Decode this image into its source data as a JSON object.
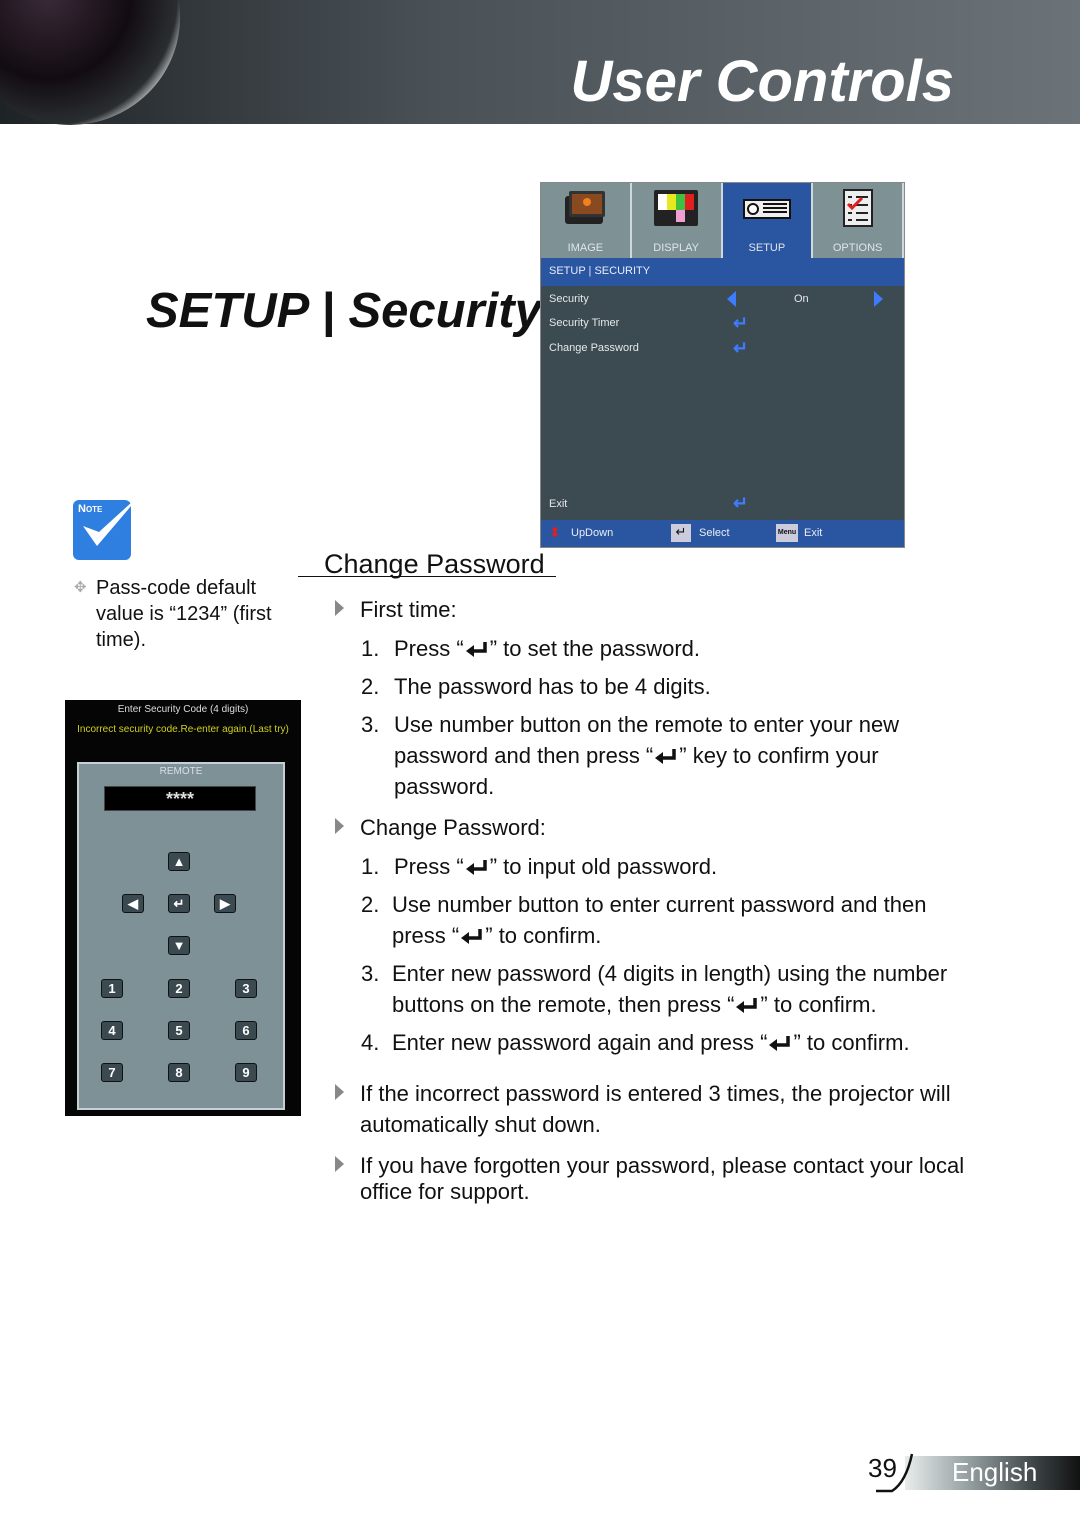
{
  "header": {
    "title": "User Controls"
  },
  "section_title": "SETUP | Security",
  "osd": {
    "tabs": [
      {
        "label": "IMAGE"
      },
      {
        "label": "DISPLAY"
      },
      {
        "label": "SETUP"
      },
      {
        "label": "OPTIONS"
      }
    ],
    "active_tab": "SETUP",
    "breadcrumb": "SETUP | SECURITY",
    "rows": [
      {
        "label": "Security",
        "value": "On"
      },
      {
        "label": "Security Timer"
      },
      {
        "label": "Change Password"
      }
    ],
    "exit": "Exit",
    "footer": {
      "updown": "UpDown",
      "select": "Select",
      "menu_key": "Menu",
      "exit": "Exit"
    },
    "accent": "#2a55a0"
  },
  "note": {
    "badge": "Note",
    "text": "Pass-code default value is “1234” (first time)."
  },
  "dialog": {
    "title": "Enter Security Code (4 digits)",
    "error": "Incorrect security code.Re-enter again.(Last try)",
    "remote_label": "REMOTE",
    "code": "****",
    "keys": [
      "1",
      "2",
      "3",
      "4",
      "5",
      "6",
      "7",
      "8",
      "9"
    ]
  },
  "content": {
    "heading": "Change Password",
    "first_time": "First time:",
    "ft": {
      "s1n": "1.",
      "s1a": "Press “",
      "s1b": "” to set the password.",
      "s2n": "2.",
      "s2": "The password has to be 4 digits.",
      "s3n": "3.",
      "s3a": "Use number button on the remote to enter your new",
      "s3b": "password and then press “",
      "s3c": "” key to confirm your",
      "s3d": "password."
    },
    "change": "Change Password:",
    "cp": {
      "s1n": "1.",
      "s1a": "Press “",
      "s1b": "” to input old password.",
      "s2n": "2.",
      "s2a": "Use number button to enter current password and then",
      "s2b": "press “",
      "s2c": "” to confirm.",
      "s3n": "3.",
      "s3a": "Enter new password (4 digits in length) using the number",
      "s3b": "buttons on the remote, then press “",
      "s3c": "” to confirm.",
      "s4n": "4.",
      "s4a": "Enter new password again and press “",
      "s4b": "” to confirm."
    },
    "incorrect_a": "If the incorrect password is entered 3 times, the projector will",
    "incorrect_b": "automatically shut down.",
    "forgot_a": "If you have forgotten your password, please contact your local",
    "forgot_b": "office for support."
  },
  "footer": {
    "page": "39",
    "language": "English"
  }
}
